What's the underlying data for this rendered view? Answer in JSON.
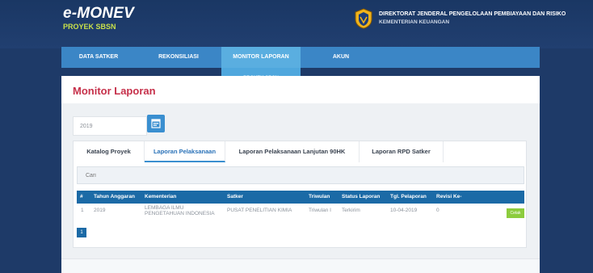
{
  "header": {
    "app_title": "e-MONEV",
    "app_subtitle": "PROYEK SBSN",
    "org_name": "DIREKTORAT JENDERAL PENGELOLAAN PEMBIAYAAN DAN RISIKO",
    "org_sub": "KEMENTERIAN KEUANGAN",
    "emblem_icon": "kemenkeu-emblem-icon"
  },
  "nav": {
    "items": [
      {
        "label": "DATA SATKER"
      },
      {
        "label": "REKONSILIASI"
      },
      {
        "label": "MONITOR LAPORAN"
      },
      {
        "label": "AKUN"
      }
    ],
    "dropdown_item": "PROYEK SBSN"
  },
  "page": {
    "title": "Monitor Laporan",
    "year_value": "2019",
    "calendar_icon": "calendar-icon"
  },
  "tabs": [
    {
      "label": "Katalog Proyek"
    },
    {
      "label": "Laporan Pelaksanaan"
    },
    {
      "label": "Laporan Pelaksanaan Lanjutan 90HK"
    },
    {
      "label": "Laporan RPD Satker"
    }
  ],
  "search": {
    "placeholder": "Cari"
  },
  "table": {
    "headers": [
      "#",
      "Tahun Anggaran",
      "Kementerian",
      "Satker",
      "Triwulan",
      "Status Laporan",
      "Tgl. Pelaporan",
      "Revisi Ke-"
    ],
    "rows": [
      {
        "no": "1",
        "tahun": "2019",
        "kementerian_line1": "LEMBAGA ILMU",
        "kementerian_line2": "PENGETAHUAN INDONESIA",
        "satker": "PUSAT PENELITIAN KIMIA",
        "triwulan": "Triwulan I",
        "status": "Terkirim",
        "tgl": "10-04-2019",
        "revisi": "0",
        "action": "Cetak"
      }
    ]
  },
  "pagination": {
    "current": "1"
  },
  "colors": {
    "brand_dark": "#1e3a68",
    "nav_blue": "#3b86c6",
    "accent_red": "#c6304a",
    "table_header": "#1b6aa6",
    "action_green": "#8ccc3d"
  }
}
